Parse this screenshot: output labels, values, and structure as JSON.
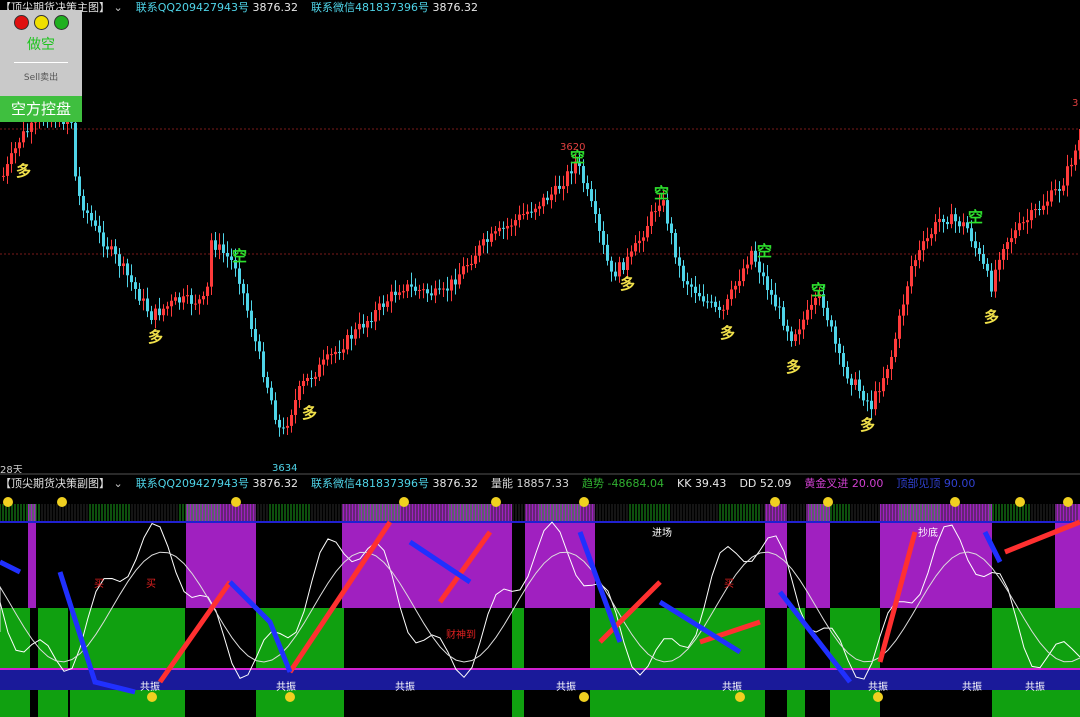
{
  "main_header": {
    "title": "【顶尖期货决策主图】",
    "qq_label": "联系QQ209427943号",
    "qq_value": "3876.32",
    "wechat_label": "联系微信481837396号",
    "wechat_value": "3876.32"
  },
  "sub_header": {
    "title": "【顶尖期货决策副图】",
    "qq_label": "联系QQ209427943号",
    "qq_value": "3876.32",
    "wechat_label": "联系微信481837396号",
    "wechat_value": "3876.32",
    "volume_label": "量能",
    "volume_value": "18857.33",
    "trend_label": "趋势",
    "trend_value": "-48684.04",
    "kk_label": "KK",
    "kk_value": "39.43",
    "dd_label": "DD",
    "dd_value": "52.09",
    "gold_label": "黄金叉进",
    "gold_value": "20.00",
    "extra_label": "顶部见顶",
    "extra_value": "90.00"
  },
  "signal_panel": {
    "signal": "做空",
    "sell": "Sell卖出",
    "control": "空方控盘"
  },
  "main_chart": {
    "high_label": "3620",
    "low_label": "3634",
    "right_label": "3",
    "days_label": "28天",
    "long_mark": "多",
    "short_mark": "空"
  },
  "sub_chart": {
    "resonance": "共振",
    "buy": "买",
    "enter": "进场",
    "copy_bottom": "抄底",
    "bottom_words": "财神到"
  },
  "colors": {
    "up": "#ff3b3b",
    "down": "#4fd4e8",
    "long": "#f0e04a",
    "short": "#2ee02e",
    "magenta": "#a020c0",
    "green": "#10a010"
  }
}
